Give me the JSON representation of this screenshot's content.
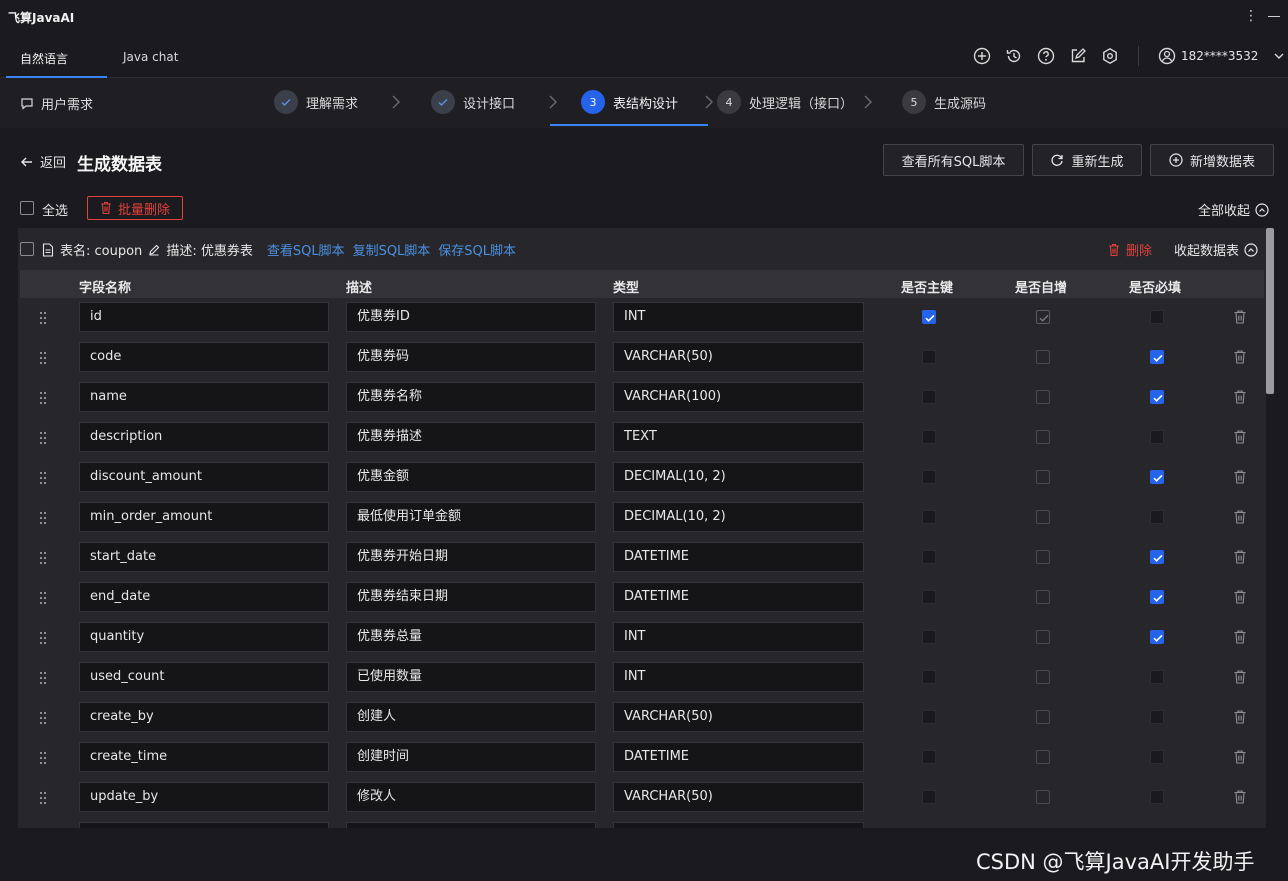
{
  "app": {
    "title": "飞算JavaAI"
  },
  "tabs": [
    {
      "label": "自然语言"
    },
    {
      "label": "Java chat"
    }
  ],
  "user": {
    "name": "182****3532"
  },
  "steps_bar": {
    "requirement_label": "用户需求",
    "steps": [
      {
        "number": "",
        "label": "理解需求",
        "state": "done"
      },
      {
        "number": "",
        "label": "设计接口",
        "state": "done"
      },
      {
        "number": "3",
        "label": "表结构设计",
        "state": "active"
      },
      {
        "number": "4",
        "label": "处理逻辑（接口）",
        "state": "pending"
      },
      {
        "number": "5",
        "label": "生成源码",
        "state": "pending"
      }
    ]
  },
  "header": {
    "back_label": "返回",
    "title": "生成数据表",
    "buttons": {
      "view_sql": "查看所有SQL脚本",
      "regenerate": "重新生成",
      "add_table": "新增数据表"
    }
  },
  "selection": {
    "select_all": "全选",
    "batch_delete": "批量删除",
    "collapse_all": "全部收起"
  },
  "table": {
    "name_label": "表名: coupon",
    "desc_label": "描述: 优惠券表",
    "links": {
      "view_sql": "查看SQL脚本",
      "copy_sql": "复制SQL脚本",
      "save_sql": "保存SQL脚本"
    },
    "delete_label": "删除",
    "collapse_label": "收起数据表",
    "columns": {
      "field": "字段名称",
      "desc": "描述",
      "type": "类型",
      "pk": "是否主键",
      "auto_inc": "是否自增",
      "required": "是否必填"
    },
    "rows": [
      {
        "field": "id",
        "desc": "优惠券ID",
        "type": "INT",
        "pk": true,
        "auto_inc": true,
        "required": false
      },
      {
        "field": "code",
        "desc": "优惠券码",
        "type": "VARCHAR(50)",
        "pk": false,
        "auto_inc": false,
        "required": true
      },
      {
        "field": "name",
        "desc": "优惠券名称",
        "type": "VARCHAR(100)",
        "pk": false,
        "auto_inc": false,
        "required": true
      },
      {
        "field": "description",
        "desc": "优惠券描述",
        "type": "TEXT",
        "pk": false,
        "auto_inc": false,
        "required": false
      },
      {
        "field": "discount_amount",
        "desc": "优惠金额",
        "type": "DECIMAL(10, 2)",
        "pk": false,
        "auto_inc": false,
        "required": true
      },
      {
        "field": "min_order_amount",
        "desc": "最低使用订单金额",
        "type": "DECIMAL(10, 2)",
        "pk": false,
        "auto_inc": false,
        "required": false
      },
      {
        "field": "start_date",
        "desc": "优惠券开始日期",
        "type": "DATETIME",
        "pk": false,
        "auto_inc": false,
        "required": true
      },
      {
        "field": "end_date",
        "desc": "优惠券结束日期",
        "type": "DATETIME",
        "pk": false,
        "auto_inc": false,
        "required": true
      },
      {
        "field": "quantity",
        "desc": "优惠券总量",
        "type": "INT",
        "pk": false,
        "auto_inc": false,
        "required": true
      },
      {
        "field": "used_count",
        "desc": "已使用数量",
        "type": "INT",
        "pk": false,
        "auto_inc": false,
        "required": false
      },
      {
        "field": "create_by",
        "desc": "创建人",
        "type": "VARCHAR(50)",
        "pk": false,
        "auto_inc": false,
        "required": false
      },
      {
        "field": "create_time",
        "desc": "创建时间",
        "type": "DATETIME",
        "pk": false,
        "auto_inc": false,
        "required": false
      },
      {
        "field": "update_by",
        "desc": "修改人",
        "type": "VARCHAR(50)",
        "pk": false,
        "auto_inc": false,
        "required": false
      },
      {
        "field": "",
        "desc": "",
        "type": "",
        "pk": false,
        "auto_inc": false,
        "required": false
      }
    ]
  },
  "watermark": {
    "text": "CSDN @飞算JavaAI开发助手"
  },
  "colors": {
    "accent": "#2563eb",
    "danger": "#e0413b",
    "link": "#4a90e2"
  }
}
